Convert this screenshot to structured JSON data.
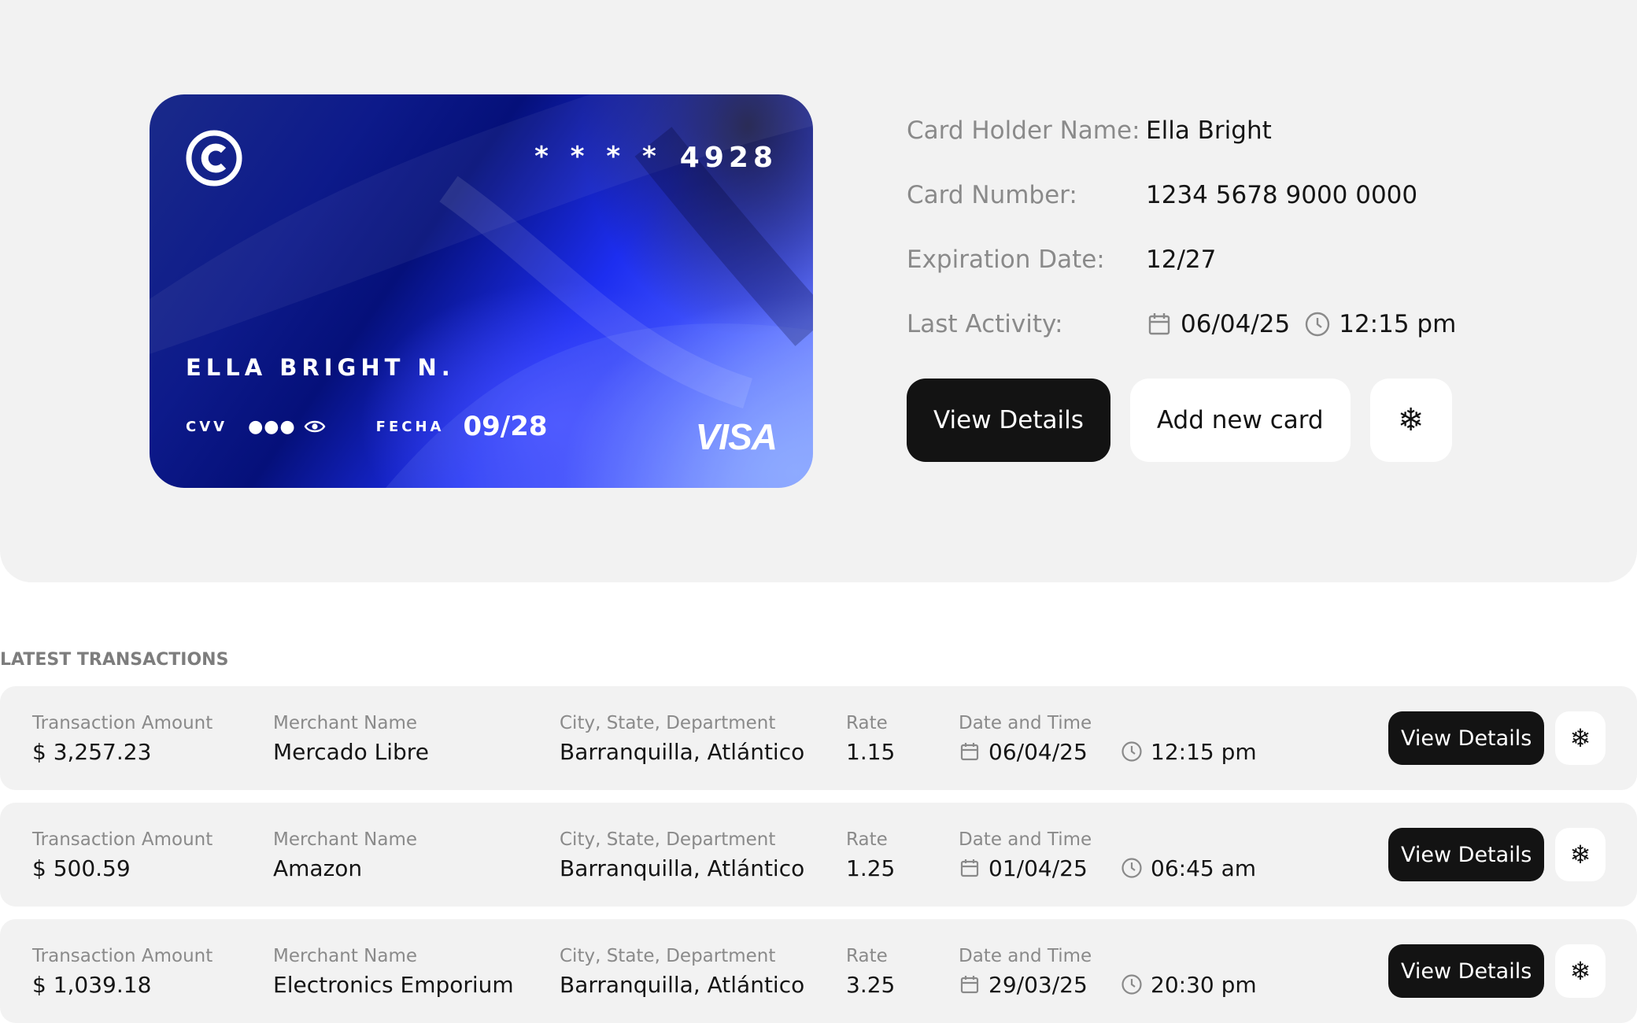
{
  "card": {
    "last_digits_mask": "* * * *",
    "last_digits": "4928",
    "holder": "ELLA BRIGHT N.",
    "cvv_label": "CVV",
    "cvv_mask": "●●●",
    "expiry_label": "FECHA",
    "expiry": "09/28",
    "network": "VISA",
    "brand_logo_icon": "c-logo-icon"
  },
  "info": {
    "holder_label": "Card Holder Name:",
    "holder_value": "Ella Bright",
    "number_label": "Card Number:",
    "number_value": "1234 5678 9000 0000",
    "expiry_label": "Expiration Date:",
    "expiry_value": "12/27",
    "activity_label": "Last Activity:",
    "activity_date": "06/04/25",
    "activity_time": "12:15 pm"
  },
  "actions": {
    "view_details": "View Details",
    "add_card": "Add new card",
    "freeze_icon": "snowflake-icon"
  },
  "transactions": {
    "title": "LATEST TRANSACTIONS",
    "labels": {
      "amount": "Transaction Amount",
      "merchant": "Merchant Name",
      "city": "City, State, Department",
      "rate": "Rate",
      "datetime": "Date and Time"
    },
    "view_label": "View Details",
    "rows": [
      {
        "amount": "$ 3,257.23",
        "merchant": "Mercado Libre",
        "city": "Barranquilla, Atlántico",
        "rate": "1.15",
        "date": "06/04/25",
        "time": "12:15 pm"
      },
      {
        "amount": "$ 500.59",
        "merchant": "Amazon",
        "city": "Barranquilla, Atlántico",
        "rate": "1.25",
        "date": "01/04/25",
        "time": "06:45 am"
      },
      {
        "amount": "$ 1,039.18",
        "merchant": "Electronics Emporium",
        "city": "Barranquilla, Atlántico",
        "rate": "3.25",
        "date": "29/03/25",
        "time": "20:30 pm"
      }
    ]
  },
  "colors": {
    "panel_bg": "#f2f2f2",
    "button_dark": "#131313",
    "label_gray": "#8a8a8a",
    "card_blue": "#1d2ef0"
  }
}
